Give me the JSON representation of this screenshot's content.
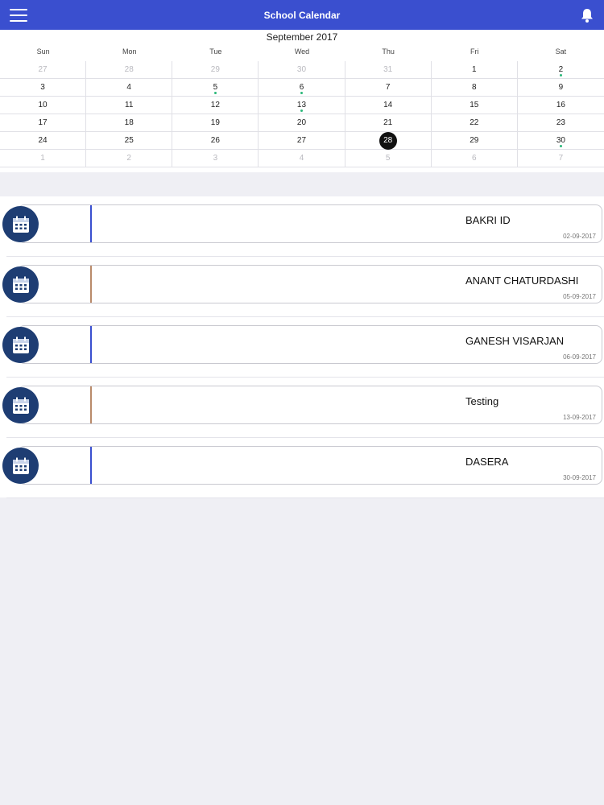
{
  "app": {
    "title": "School Calendar"
  },
  "icons": {
    "menu": "hamburger-menu-icon",
    "notifications": "bell-icon",
    "event": "calendar-icon"
  },
  "colors": {
    "header": "#3a4fcf",
    "accent_blue": "#3a4fcf",
    "accent_brown": "#b98a6a",
    "icon_bg": "#1e3d73"
  },
  "calendar": {
    "month_label": "September 2017",
    "weekdays": [
      "Sun",
      "Mon",
      "Tue",
      "Wed",
      "Thu",
      "Fri",
      "Sat"
    ],
    "days": [
      {
        "label": "27",
        "muted": true
      },
      {
        "label": "28",
        "muted": true
      },
      {
        "label": "29",
        "muted": true
      },
      {
        "label": "30",
        "muted": true
      },
      {
        "label": "31",
        "muted": true
      },
      {
        "label": "1"
      },
      {
        "label": "2",
        "dot": true
      },
      {
        "label": "3"
      },
      {
        "label": "4"
      },
      {
        "label": "5",
        "dot": true
      },
      {
        "label": "6",
        "dot": true
      },
      {
        "label": "7"
      },
      {
        "label": "8"
      },
      {
        "label": "9"
      },
      {
        "label": "10"
      },
      {
        "label": "11"
      },
      {
        "label": "12"
      },
      {
        "label": "13",
        "dot": true
      },
      {
        "label": "14"
      },
      {
        "label": "15"
      },
      {
        "label": "16"
      },
      {
        "label": "17"
      },
      {
        "label": "18"
      },
      {
        "label": "19"
      },
      {
        "label": "20"
      },
      {
        "label": "21"
      },
      {
        "label": "22"
      },
      {
        "label": "23"
      },
      {
        "label": "24"
      },
      {
        "label": "25"
      },
      {
        "label": "26"
      },
      {
        "label": "27"
      },
      {
        "label": "28",
        "today": true
      },
      {
        "label": "29"
      },
      {
        "label": "30",
        "dot": true
      },
      {
        "label": "1",
        "muted": true
      },
      {
        "label": "2",
        "muted": true
      },
      {
        "label": "3",
        "muted": true
      },
      {
        "label": "4",
        "muted": true
      },
      {
        "label": "5",
        "muted": true
      },
      {
        "label": "6",
        "muted": true
      },
      {
        "label": "7",
        "muted": true
      }
    ]
  },
  "events": [
    {
      "name": "BAKRI ID",
      "date": "02-09-2017",
      "accent": "#3a4fcf"
    },
    {
      "name": "ANANT CHATURDASHI",
      "date": "05-09-2017",
      "accent": "#b98a6a"
    },
    {
      "name": "GANESH VISARJAN",
      "date": "06-09-2017",
      "accent": "#3a4fcf"
    },
    {
      "name": "Testing",
      "date": "13-09-2017",
      "accent": "#b98a6a"
    },
    {
      "name": "DASERA",
      "date": "30-09-2017",
      "accent": "#3a4fcf"
    }
  ]
}
